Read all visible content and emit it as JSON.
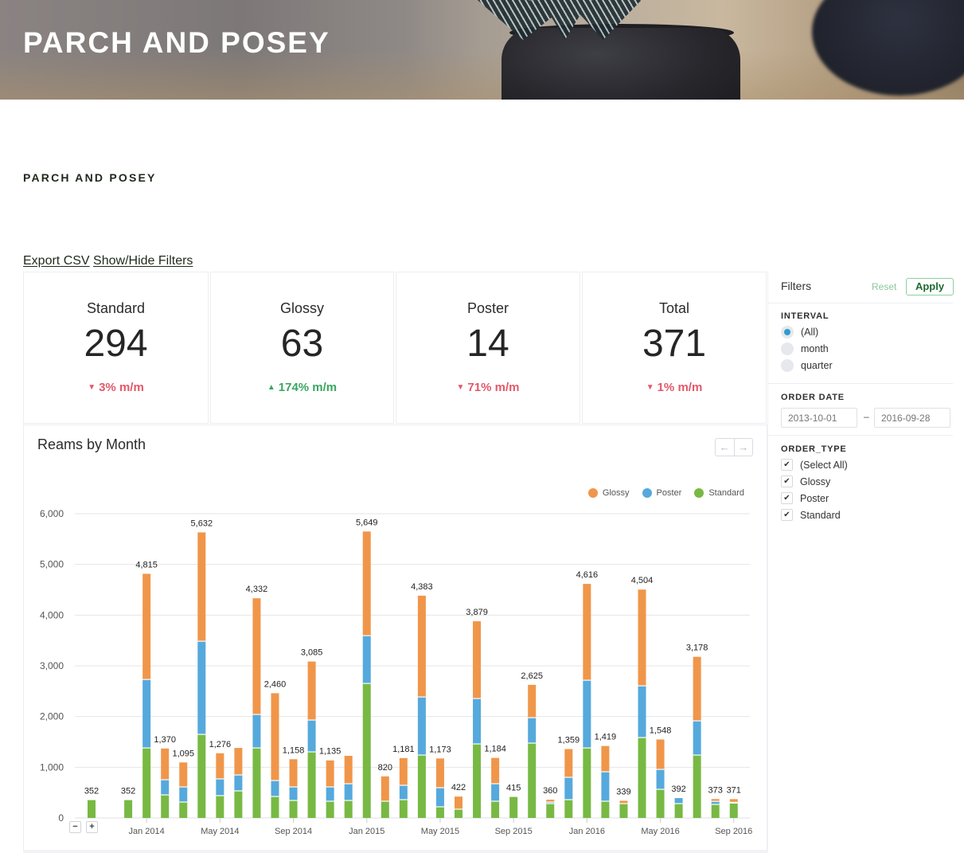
{
  "header": {
    "banner_title": "PARCH AND POSEY",
    "section_title": "PARCH AND POSEY"
  },
  "toolbar": {
    "export_csv": "Export CSV",
    "show_hide_filters": "Show/Hide Filters"
  },
  "kpis": [
    {
      "label": "Standard",
      "value": "294",
      "delta": "3% m/m",
      "direction": "down"
    },
    {
      "label": "Glossy",
      "value": "63",
      "delta": "174% m/m",
      "direction": "up"
    },
    {
      "label": "Poster",
      "value": "14",
      "delta": "71% m/m",
      "direction": "down"
    },
    {
      "label": "Total",
      "value": "371",
      "delta": "1% m/m",
      "direction": "down"
    }
  ],
  "icons": {
    "down": "▼",
    "up": "▲",
    "prev": "←",
    "next": "→",
    "zoom_out": "−",
    "zoom_in": "+",
    "check": "✔"
  },
  "chart_panel": {
    "title": "Reams by Month"
  },
  "colors": {
    "glossy": "#f0964a",
    "poster": "#56a9dc",
    "standard": "#78b944",
    "negative": "#e2586a",
    "positive": "#3aa661",
    "radio_selected": "#2e9ccc",
    "apply_text": "#1d6b33"
  },
  "chart_data": {
    "type": "bar",
    "stacked": true,
    "title": "Reams by Month",
    "xlabel": "",
    "ylabel": "",
    "ylim": [
      0,
      6000
    ],
    "yticks": [
      0,
      1000,
      2000,
      3000,
      4000,
      5000,
      6000
    ],
    "ytick_labels": [
      "0",
      "1,000",
      "2,000",
      "3,000",
      "4,000",
      "5,000",
      "6,000"
    ],
    "grid": true,
    "legend": "top-right",
    "legend_order": [
      "Glossy",
      "Poster",
      "Standard"
    ],
    "xtick_labels": [
      "Jan 2014",
      "May 2014",
      "Sep 2014",
      "Jan 2015",
      "May 2015",
      "Sep 2015",
      "Jan 2016",
      "May 2016",
      "Sep 2016"
    ],
    "categories": [
      "Oct 2013",
      "Nov 2013",
      "Dec 2013",
      "Jan 2014",
      "Feb 2014",
      "Mar 2014",
      "Apr 2014",
      "May 2014",
      "Jun 2014",
      "Jul 2014",
      "Aug 2014",
      "Sep 2014",
      "Oct 2014",
      "Nov 2014",
      "Dec 2014",
      "Jan 2015",
      "Feb 2015",
      "Mar 2015",
      "Apr 2015",
      "May 2015",
      "Jun 2015",
      "Jul 2015",
      "Aug 2015",
      "Sep 2015",
      "Oct 2015",
      "Nov 2015",
      "Dec 2015",
      "Jan 2016",
      "Feb 2016",
      "Mar 2016",
      "Apr 2016",
      "May 2016",
      "Jun 2016",
      "Jul 2016",
      "Aug 2016",
      "Sep 2016"
    ],
    "series": [
      {
        "name": "Standard",
        "values": [
          352,
          0,
          352,
          1381,
          455,
          314,
          1648,
          440,
          534,
          1381,
          424,
          345,
          1303,
          330,
          345,
          2653,
          330,
          361,
          1240,
          220,
          173,
          1460,
          330,
          415,
          1476,
          283,
          361,
          1381,
          330,
          283,
          1586,
          565,
          283,
          1240,
          267,
          294
        ]
      },
      {
        "name": "Poster",
        "values": [
          0,
          0,
          0,
          1350,
          299,
          298,
          1837,
          330,
          314,
          660,
          314,
          267,
          628,
          282,
          330,
          942,
          0,
          283,
          1146,
          377,
          0,
          895,
          345,
          0,
          502,
          30,
          440,
          1335,
          581,
          0,
          1020,
          393,
          109,
          675,
          60,
          14
        ]
      },
      {
        "name": "Glossy",
        "values": [
          0,
          0,
          0,
          2084,
          616,
          483,
          2147,
          506,
          533,
          2291,
          1722,
          546,
          1154,
          523,
          550,
          2054,
          490,
          537,
          1997,
          576,
          249,
          1524,
          509,
          0,
          647,
          47,
          558,
          1900,
          508,
          56,
          1898,
          590,
          0,
          1263,
          46,
          63
        ]
      }
    ],
    "totals_labels": [
      "352",
      "",
      "352",
      "4,815",
      "1,370",
      "1,095",
      "5,632",
      "1,276",
      "",
      "4,332",
      "2,460",
      "1,158",
      "3,085",
      "1,135",
      "",
      "5,649",
      "820",
      "1,181",
      "4,383",
      "1,173",
      "422",
      "3,879",
      "1,184",
      "415",
      "2,625",
      "360",
      "1,359",
      "4,616",
      "1,419",
      "339",
      "4,504",
      "1,548",
      "392",
      "3,178",
      "373",
      "371"
    ]
  },
  "filters": {
    "title": "Filters",
    "reset": "Reset",
    "apply": "Apply",
    "interval": {
      "label": "INTERVAL",
      "options": [
        {
          "label": "(All)",
          "selected": true
        },
        {
          "label": "month",
          "selected": false
        },
        {
          "label": "quarter",
          "selected": false
        }
      ]
    },
    "order_date": {
      "label": "ORDER DATE",
      "start_placeholder": "2013-10-01",
      "end_placeholder": "2016-09-28",
      "separator": "–"
    },
    "order_type": {
      "label": "ORDER_TYPE",
      "options": [
        {
          "label": "(Select All)",
          "checked": true
        },
        {
          "label": "Glossy",
          "checked": true
        },
        {
          "label": "Poster",
          "checked": true
        },
        {
          "label": "Standard",
          "checked": true
        }
      ]
    }
  }
}
